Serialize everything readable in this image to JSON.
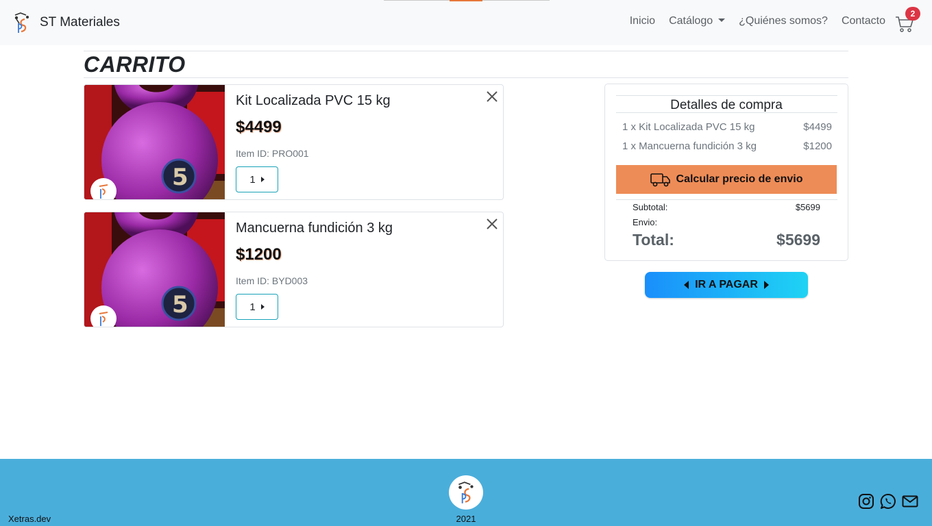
{
  "brand": {
    "name": "ST Materiales"
  },
  "nav": {
    "links": [
      "Inicio",
      "Catálogo",
      "¿Quiénes somos?",
      "Contacto"
    ],
    "cart_count": "2"
  },
  "page": {
    "title": "CARRITO"
  },
  "cart": {
    "items": [
      {
        "name": "Kit Localizada PVC 15 kg",
        "price": "$4499",
        "item_id": "Item ID: PRO001",
        "qty": "1"
      },
      {
        "name": "Mancuerna fundición 3 kg",
        "price": "$1200",
        "item_id": "Item ID: BYD003",
        "qty": "1"
      }
    ]
  },
  "summary": {
    "title": "Detalles de compra",
    "lines": [
      {
        "label": "1 x Kit Localizada PVC 15 kg",
        "price": "$4499"
      },
      {
        "label": "1 x Mancuerna fundición 3 kg",
        "price": "$1200"
      }
    ],
    "shipping_button": "Calcular precio de envio",
    "subtotal_label": "Subtotal:",
    "subtotal_value": "$5699",
    "shipping_label": "Envio:",
    "total_label": "Total:",
    "total_value": "$5699"
  },
  "checkout": {
    "label": "IR A PAGAR"
  },
  "footer": {
    "dev": "Xetras.dev",
    "year": "2021"
  },
  "colors": {
    "accent": "#ee8c57",
    "footer": "#4aaedb",
    "badge": "#dc3545",
    "qty_border": "#17a2b8"
  },
  "icons": [
    "brand-logo-icon",
    "cart-icon",
    "close-icon",
    "truck-icon",
    "instagram-icon",
    "whatsapp-icon",
    "mail-icon"
  ]
}
